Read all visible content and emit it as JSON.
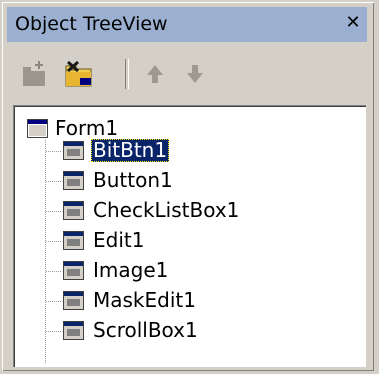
{
  "window": {
    "title": "Object TreeView",
    "close_glyph": "✕"
  },
  "toolbar": {
    "buttons": [
      {
        "name": "new-item-icon",
        "enabled": false
      },
      {
        "name": "delete-item-icon",
        "enabled": true
      },
      {
        "name": "move-up-icon",
        "enabled": false
      },
      {
        "name": "move-down-icon",
        "enabled": false
      }
    ]
  },
  "tree": {
    "root": {
      "label": "Form1",
      "icon": "form-icon"
    },
    "children": [
      {
        "label": "BitBtn1",
        "icon": "component-icon",
        "selected": true
      },
      {
        "label": "Button1",
        "icon": "component-icon",
        "selected": false
      },
      {
        "label": "CheckListBox1",
        "icon": "component-icon",
        "selected": false
      },
      {
        "label": "Edit1",
        "icon": "component-icon",
        "selected": false
      },
      {
        "label": "Image1",
        "icon": "component-icon",
        "selected": false
      },
      {
        "label": "MaskEdit1",
        "icon": "component-icon",
        "selected": false
      },
      {
        "label": "ScrollBox1",
        "icon": "component-icon",
        "selected": false
      }
    ]
  },
  "colors": {
    "title_bar": "#9bb0d1",
    "selection": "#0a246a",
    "face": "#d4d0c8"
  }
}
